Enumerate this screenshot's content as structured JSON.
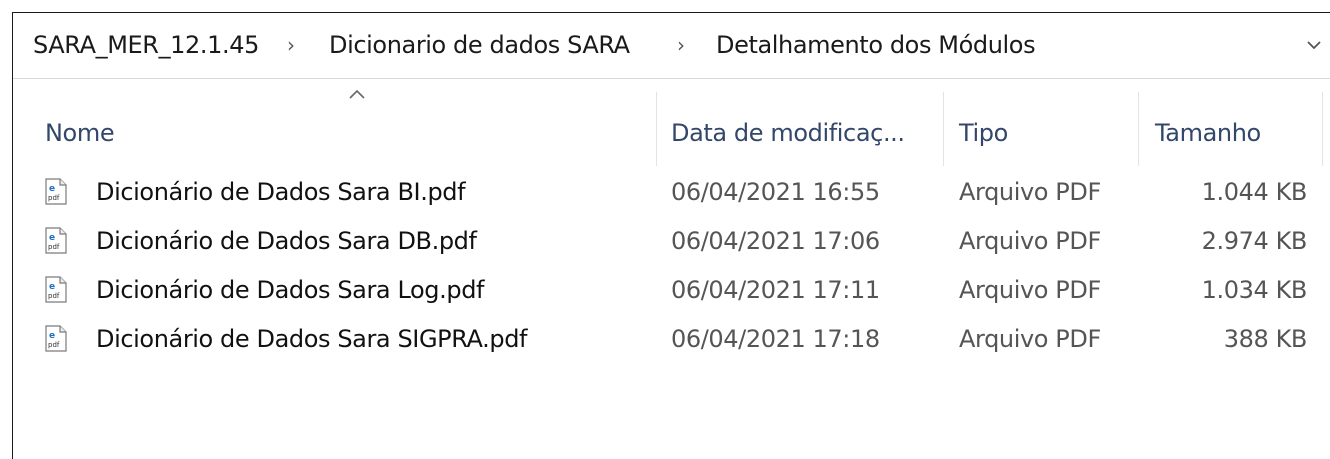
{
  "breadcrumb": {
    "items": [
      {
        "label": "SARA_MER_12.1.45"
      },
      {
        "label": "Dicionario de dados SARA"
      },
      {
        "label": "Detalhamento dos Módulos"
      }
    ],
    "separator_icon": "chevron-right-icon",
    "dropdown_icon": "chevron-down-icon"
  },
  "columns": {
    "name": "Nome",
    "date": "Data de modificaç...",
    "type": "Tipo",
    "size": "Tamanho",
    "sort_icon": "sort-ascending-icon"
  },
  "files": [
    {
      "name": "Dicionário de Dados Sara BI.pdf",
      "date": "06/04/2021 16:55",
      "type": "Arquivo PDF",
      "size": "1.044 KB",
      "icon": "pdf-file-icon"
    },
    {
      "name": "Dicionário de Dados Sara DB.pdf",
      "date": "06/04/2021 17:06",
      "type": "Arquivo PDF",
      "size": "2.974 KB",
      "icon": "pdf-file-icon"
    },
    {
      "name": "Dicionário de Dados Sara Log.pdf",
      "date": "06/04/2021 17:11",
      "type": "Arquivo PDF",
      "size": "1.034 KB",
      "icon": "pdf-file-icon"
    },
    {
      "name": "Dicionário de Dados Sara SIGPRA.pdf",
      "date": "06/04/2021 17:18",
      "type": "Arquivo PDF",
      "size": "388 KB",
      "icon": "pdf-file-icon"
    }
  ],
  "colors": {
    "header_text": "#33476b",
    "detail_text": "#555555",
    "icon_accent": "#1f6fc5"
  }
}
